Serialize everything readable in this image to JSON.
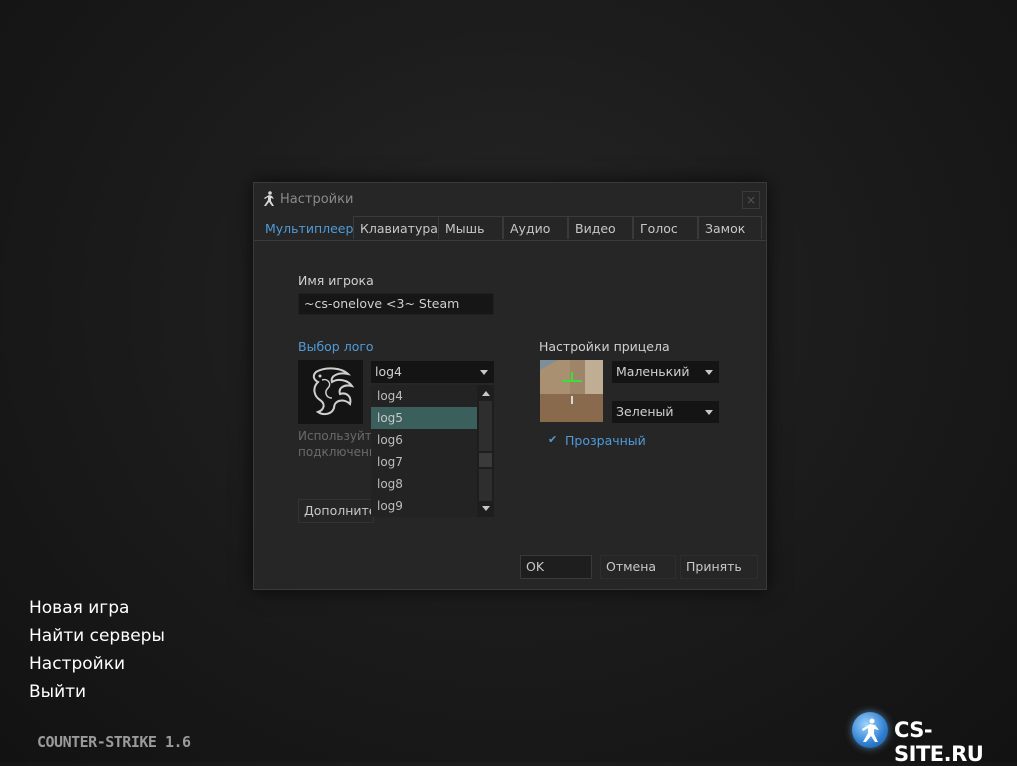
{
  "dialog": {
    "title": "Настройки",
    "close_glyph": "×",
    "tabs": [
      "Мультиплеер",
      "Клавиатура",
      "Мышь",
      "Аудио",
      "Видео",
      "Голос",
      "Замок"
    ],
    "active_tab": 0,
    "player_name": {
      "label": "Имя игрока",
      "value": "~cs-onelove <3~  Steam"
    },
    "logo": {
      "label": "Выбор лого",
      "selected": "log4",
      "options": [
        "log4",
        "log5",
        "log6",
        "log7",
        "log8",
        "log9"
      ],
      "highlighted": "log5",
      "hint_line1": "Используйте",
      "hint_line2": "подключени",
      "advanced_button": "Дополнител"
    },
    "crosshair": {
      "label": "Настройки прицела",
      "size": "Маленький",
      "color": "Зеленый",
      "translucent_label": "Прозрачный",
      "translucent_checked": true,
      "check_glyph": "✔"
    },
    "buttons": {
      "ok": "OK",
      "cancel": "Отмена",
      "apply": "Принять"
    }
  },
  "main_menu": [
    "Новая игра",
    "Найти серверы",
    "Настройки",
    "Выйти"
  ],
  "game_logo": "COUNTER-STRIKE 1.6",
  "watermark": "CS-SITE.RU",
  "colors": {
    "accent": "#4f9bd9",
    "dialog_bg": "#262626",
    "selection": "#3a5f5c",
    "crosshair": "#3adf3a"
  }
}
